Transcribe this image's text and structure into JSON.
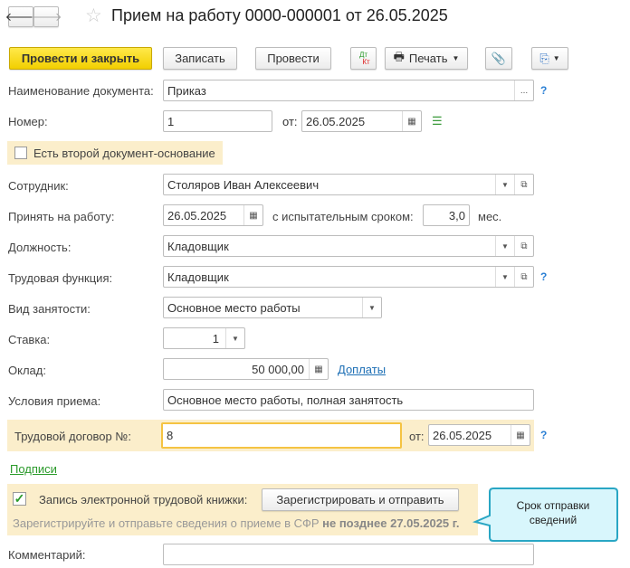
{
  "header": {
    "title": "Прием на работу 0000-000001 от 26.05.2025"
  },
  "toolbar": {
    "post_close": "Провести и закрыть",
    "save": "Записать",
    "post": "Провести",
    "dtkt_dt": "Дт",
    "dtkt_kt": "Кт",
    "print": "Печать"
  },
  "form": {
    "doc_name_label": "Наименование документа:",
    "doc_name": "Приказ",
    "number_label": "Номер:",
    "number": "1",
    "from_label": "от:",
    "date": "26.05.2025",
    "second_doc_label": "Есть второй документ-основание",
    "employee_label": "Сотрудник:",
    "employee": "Столяров Иван Алексеевич",
    "hire_label": "Принять на работу:",
    "hire_date": "26.05.2025",
    "probation_label": "с испытательным сроком:",
    "probation": "3,0",
    "months": "мес.",
    "position_label": "Должность:",
    "position": "Кладовщик",
    "function_label": "Трудовая функция:",
    "function": "Кладовщик",
    "employment_label": "Вид занятости:",
    "employment": "Основное место работы",
    "rate_label": "Ставка:",
    "rate": "1",
    "salary_label": "Оклад:",
    "salary": "50 000,00",
    "extras": "Доплаты",
    "conditions_label": "Условия приема:",
    "conditions": "Основное место работы, полная занятость",
    "contract_label": "Трудовой договор №:",
    "contract": "8",
    "contract_from": "от:",
    "contract_date": "26.05.2025",
    "signatures": "Подписи",
    "etk_label": "Запись электронной трудовой книжки:",
    "etk_button": "Зарегистрировать и отправить",
    "etk_note": "Зарегистрируйте и отправьте сведения о приеме в СФР ",
    "etk_deadline": "не позднее 27.05.2025 г.",
    "comment_label": "Комментарий:",
    "comment": "",
    "help": "?",
    "ellipsis": "..."
  },
  "callout": {
    "text": "Срок отправки сведений"
  }
}
